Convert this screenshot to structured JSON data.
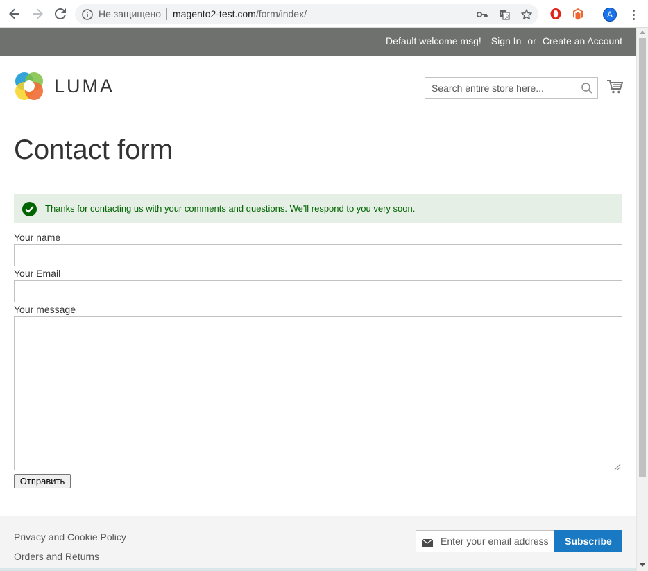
{
  "browser": {
    "security_label": "Не защищено",
    "url_host": "magento2-test.com",
    "url_path": "/form/index/",
    "avatar_letter": "A",
    "icons": [
      "back-icon",
      "forward-icon",
      "reload-icon",
      "info-icon",
      "key-icon",
      "translate-icon",
      "star-icon",
      "opera-extension-icon",
      "magento-extension-icon",
      "menu-icon"
    ]
  },
  "panel": {
    "welcome": "Default welcome msg!",
    "sign_in": "Sign In",
    "or": "or",
    "create_account": "Create an Account"
  },
  "header": {
    "logo_text": "LUMA",
    "search_placeholder": "Search entire store here...",
    "colors": {
      "blue": "#1c9ad6",
      "green": "#7cc142",
      "yellow": "#f9d423",
      "orange": "#ef6c34",
      "red": "#e74c3c"
    }
  },
  "page": {
    "title": "Contact form",
    "success_message": "Thanks for contacting us with your comments and questions. We'll respond to you very soon."
  },
  "form": {
    "name_label": "Your name",
    "name_value": "",
    "email_label": "Your Email",
    "email_value": "",
    "message_label": "Your message",
    "message_value": "",
    "submit_label": "Отправить"
  },
  "footer": {
    "links": [
      "Privacy and Cookie Policy",
      "Orders and Returns"
    ],
    "newsletter_placeholder": "Enter your email address",
    "subscribe_label": "Subscribe",
    "accent_color": "#1979c3"
  }
}
